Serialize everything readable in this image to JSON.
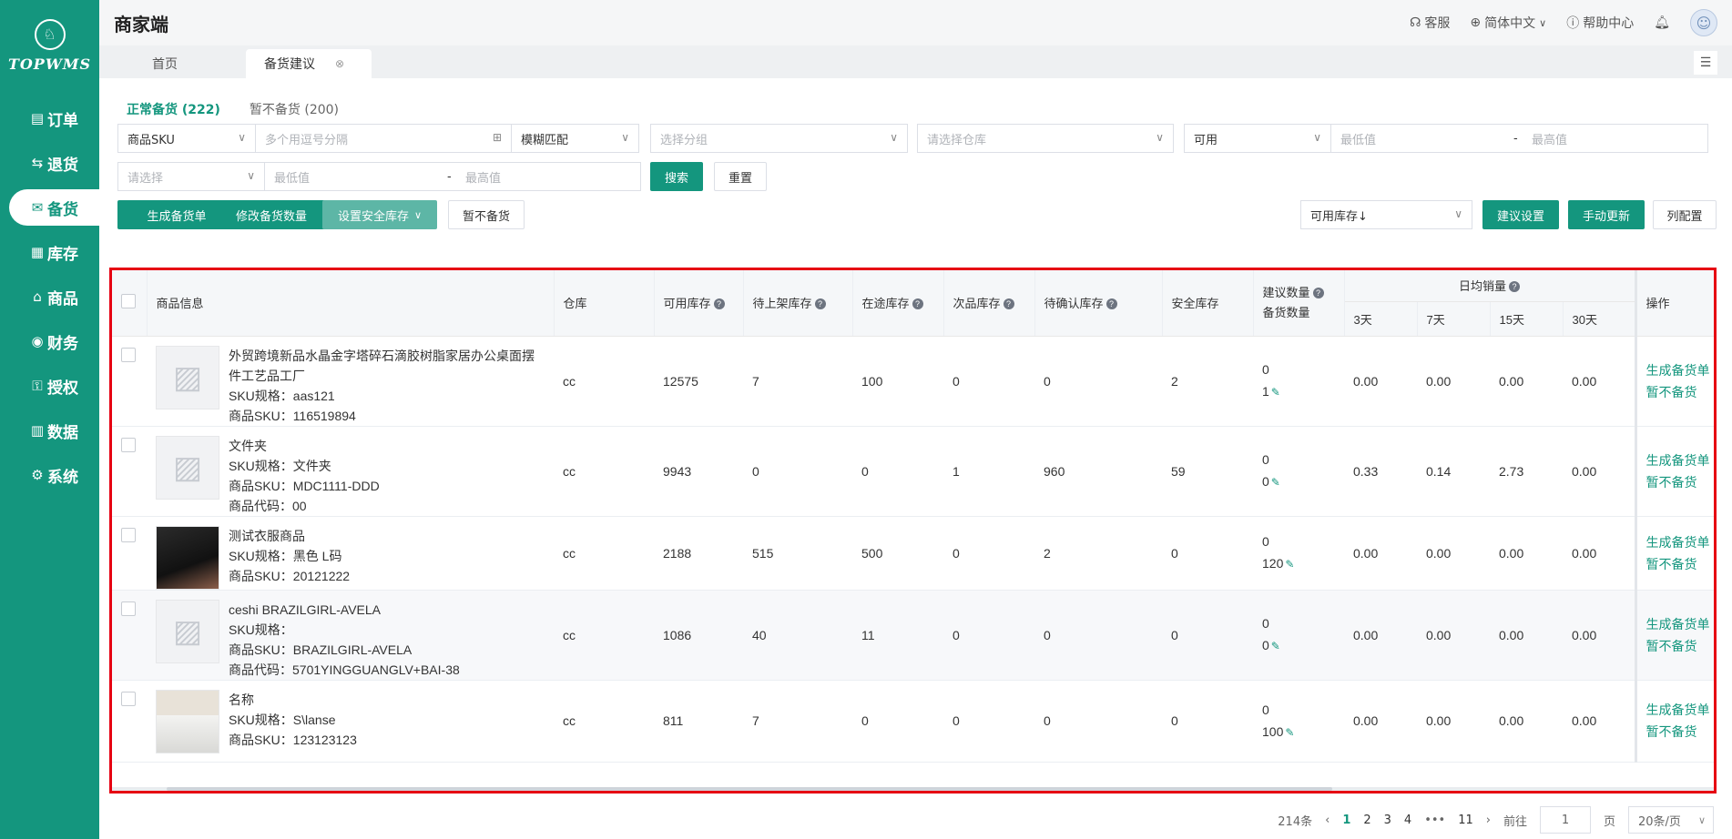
{
  "sidebar": {
    "logo_text": "TOPWMS",
    "items": [
      {
        "label": "订单",
        "icon": "order-icon",
        "active": false
      },
      {
        "label": "退货",
        "icon": "return-icon",
        "active": false
      },
      {
        "label": "备货",
        "icon": "stock-prep-icon",
        "active": true
      },
      {
        "label": "库存",
        "icon": "inventory-icon",
        "active": false
      },
      {
        "label": "商品",
        "icon": "product-icon",
        "active": false
      },
      {
        "label": "财务",
        "icon": "finance-icon",
        "active": false
      },
      {
        "label": "授权",
        "icon": "auth-icon",
        "active": false
      },
      {
        "label": "数据",
        "icon": "data-icon",
        "active": false
      },
      {
        "label": "系统",
        "icon": "system-icon",
        "active": false
      }
    ]
  },
  "header": {
    "title": "商家端",
    "service": "客服",
    "language": "简体中文",
    "help": "帮助中心"
  },
  "tabs": {
    "home": "首页",
    "current": "备货建议"
  },
  "subtabs": {
    "normal": "正常备货 (222)",
    "paused": "暂不备货 (200)"
  },
  "filters": {
    "sku_type": "商品SKU",
    "sku_input_placeholder": "多个用逗号分隔",
    "match_mode": "模糊匹配",
    "group_placeholder": "选择分组",
    "warehouse_placeholder": "请选择仓库",
    "stock_type": "可用",
    "min_placeholder": "最低值",
    "max_placeholder": "最高值",
    "dash": "-",
    "select_placeholder": "请选择",
    "min2_placeholder": "最低值",
    "max2_placeholder": "最高值",
    "search": "搜索",
    "reset": "重置"
  },
  "toolbar": {
    "generate": "生成备货单",
    "modify_qty": "修改备货数量",
    "safety_stock": "设置安全库存",
    "pause": "暂不备货",
    "sort": "可用库存↓",
    "suggest_settings": "建议设置",
    "manual_update": "手动更新",
    "column_config": "列配置"
  },
  "table": {
    "headers": {
      "product": "商品信息",
      "warehouse": "仓库",
      "available": "可用库存",
      "pending_shelf": "待上架库存",
      "in_transit": "在途库存",
      "defective": "次品库存",
      "pending_confirm": "待确认库存",
      "safety": "安全库存",
      "suggest_qty": "建议数量",
      "prep_qty": "备货数量",
      "daily_sales": "日均销量",
      "d3": "3天",
      "d7": "7天",
      "d15": "15天",
      "d30": "30天",
      "ops": "操作"
    },
    "rows": [
      {
        "thumb": "placeholder",
        "title": "外贸跨境新品水晶金字塔碎石滴胶树脂家居办公桌面摆件工艺品工厂",
        "lines": [
          "SKU规格：aas121",
          "商品SKU：116519894"
        ],
        "warehouse": "cc",
        "available": "12575",
        "pending_shelf": "7",
        "in_transit": "100",
        "defective": "0",
        "pending_confirm": "0",
        "safety": "2",
        "suggest": "0",
        "prep": "1",
        "d3": "0.00",
        "d7": "0.00",
        "d15": "0.00",
        "d30": "0.00",
        "op1": "生成备货单",
        "op2": "暂不备货",
        "alt": false
      },
      {
        "thumb": "placeholder",
        "title": "文件夹",
        "lines": [
          "SKU规格：文件夹",
          "商品SKU：MDC1111-DDD",
          "商品代码：00"
        ],
        "warehouse": "cc",
        "available": "9943",
        "pending_shelf": "0",
        "in_transit": "0",
        "defective": "1",
        "pending_confirm": "960",
        "safety": "59",
        "suggest": "0",
        "prep": "0",
        "d3": "0.33",
        "d7": "0.14",
        "d15": "2.73",
        "d30": "0.00",
        "op1": "生成备货单",
        "op2": "暂不备货",
        "alt": false
      },
      {
        "thumb": "shirt",
        "title": "测试衣服商品",
        "lines": [
          "SKU规格：黑色 L码",
          "商品SKU：20121222"
        ],
        "warehouse": "cc",
        "available": "2188",
        "pending_shelf": "515",
        "in_transit": "500",
        "defective": "0",
        "pending_confirm": "2",
        "safety": "0",
        "suggest": "0",
        "prep": "120",
        "d3": "0.00",
        "d7": "0.00",
        "d15": "0.00",
        "d30": "0.00",
        "op1": "生成备货单",
        "op2": "暂不备货",
        "alt": false
      },
      {
        "thumb": "placeholder",
        "title": "ceshi BRAZILGIRL-AVELA",
        "lines": [
          "SKU规格：",
          "商品SKU：BRAZILGIRL-AVELA",
          "商品代码：5701YINGGUANGLV+BAI-38"
        ],
        "warehouse": "cc",
        "available": "1086",
        "pending_shelf": "40",
        "in_transit": "11",
        "defective": "0",
        "pending_confirm": "0",
        "safety": "0",
        "suggest": "0",
        "prep": "0",
        "d3": "0.00",
        "d7": "0.00",
        "d15": "0.00",
        "d30": "0.00",
        "op1": "生成备货单",
        "op2": "暂不备货",
        "alt": true
      },
      {
        "thumb": "pot",
        "title": "名称",
        "lines": [
          "SKU规格：S\\lanse",
          "商品SKU：123123123"
        ],
        "warehouse": "cc",
        "available": "811",
        "pending_shelf": "7",
        "in_transit": "0",
        "defective": "0",
        "pending_confirm": "0",
        "safety": "0",
        "suggest": "0",
        "prep": "100",
        "d3": "0.00",
        "d7": "0.00",
        "d15": "0.00",
        "d30": "0.00",
        "op1": "生成备货单",
        "op2": "暂不备货",
        "alt": false
      }
    ]
  },
  "pagination": {
    "total": "214条",
    "pages": [
      "1",
      "2",
      "3",
      "4"
    ],
    "ellipsis": "•••",
    "last": "11",
    "goto": "前往",
    "goto_value": "1",
    "page_unit": "页",
    "page_size": "20条/页"
  },
  "colors": {
    "brand": "#14967e",
    "highlight_border": "#e60012"
  }
}
